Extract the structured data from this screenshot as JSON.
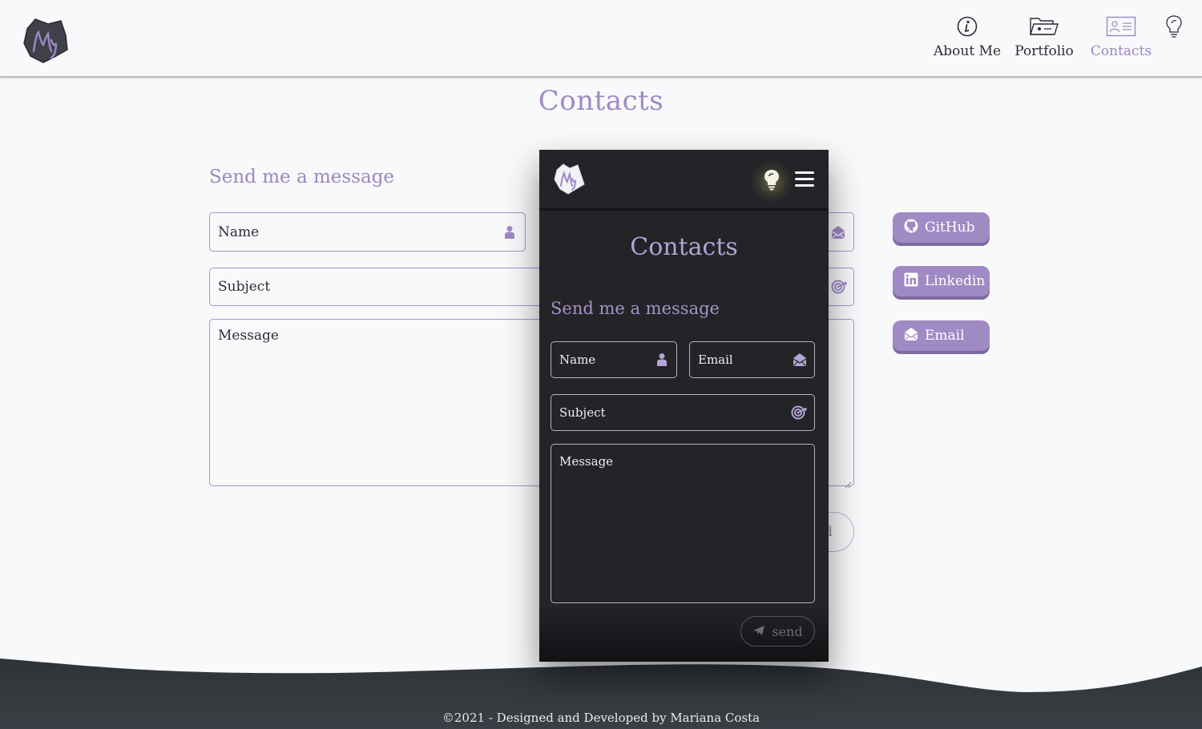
{
  "header": {
    "logo_text": "My",
    "nav": [
      {
        "label": "About Me",
        "icon": "info-icon",
        "active": false
      },
      {
        "label": "Portfolio",
        "icon": "folder-icon",
        "active": false
      },
      {
        "label": "Contacts",
        "icon": "contact-card-icon",
        "active": true
      }
    ],
    "theme_icon": "lightbulb-icon"
  },
  "page": {
    "title": "Contacts"
  },
  "form": {
    "heading": "Send me a message",
    "name_placeholder": "Name",
    "subject_placeholder": "Subject",
    "message_placeholder": "Message",
    "send_label_visible": "d"
  },
  "social": {
    "github": "GitHub",
    "linkedin": "Linkedin",
    "email": "Email"
  },
  "mobile": {
    "title": "Contacts",
    "heading": "Send me a message",
    "name_placeholder": "Name",
    "email_placeholder": "Email",
    "subject_placeholder": "Subject",
    "message_placeholder": "Message",
    "send_label": "send"
  },
  "footer": {
    "text": "©2021 - Designed and Developed by Mariana Costa"
  },
  "colors": {
    "accent": "#a08ac4",
    "dark_bg": "#222427",
    "footer_bg": "#2c3035"
  }
}
